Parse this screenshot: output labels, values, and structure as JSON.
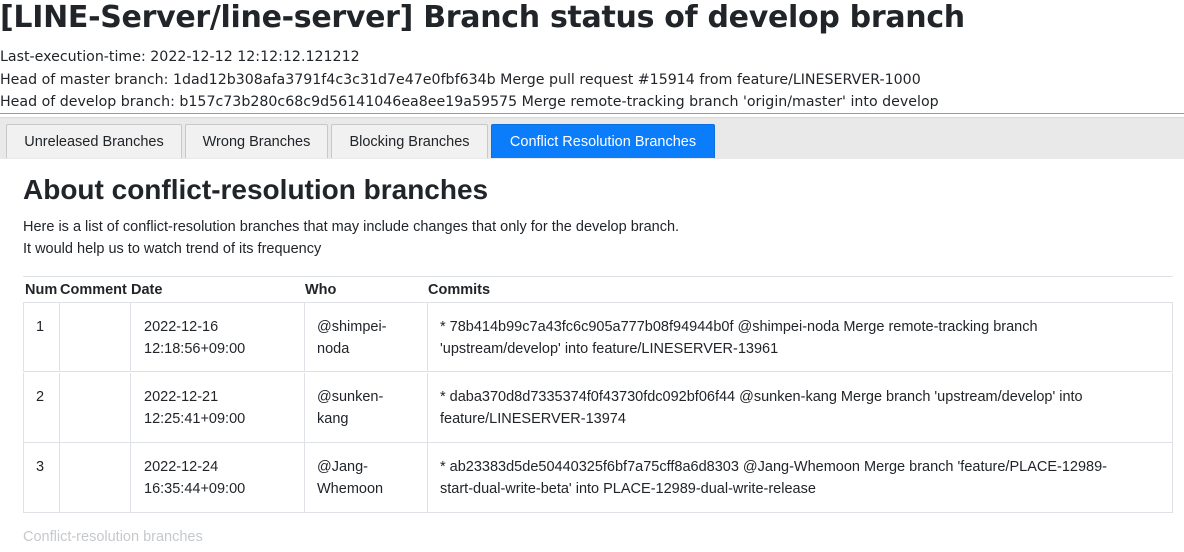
{
  "page": {
    "title": "[LINE-Server/line-server] Branch status of develop branch",
    "last_execution": "Last-execution-time: 2022-12-12 12:12:12.121212",
    "master_head": "Head of master branch: 1dad12b308afa3791f4c3c31d7e47e0fbf634b Merge pull request #15914 from feature/LINESERVER-1000",
    "develop_head": "Head of develop branch: b157c73b280c68c9d56141046ea8ee19a59575 Merge remote-tracking branch 'origin/master' into develop"
  },
  "tabs": [
    {
      "label": "Unreleased Branches",
      "active": false
    },
    {
      "label": "Wrong Branches",
      "active": false
    },
    {
      "label": "Blocking Branches",
      "active": false
    },
    {
      "label": "Conflict Resolution Branches",
      "active": true
    }
  ],
  "content": {
    "heading": "About conflict-resolution branches",
    "description_line1": "Here is a list of conflict-resolution branches that may include changes that only for the develop branch.",
    "description_line2": "It would help us to watch trend of its frequency",
    "footer_note": "Conflict-resolution branches"
  },
  "table": {
    "headers": {
      "num": "Num",
      "comment": "Comment",
      "date": "Date",
      "who": "Who",
      "commits": "Commits"
    },
    "rows": [
      {
        "num": "1",
        "comment": "",
        "date_line1": "2022-12-16",
        "date_line2": "12:18:56+09:00",
        "who_line1": "@shimpei-",
        "who_line2": "noda",
        "commits_line1": "* 78b414b99c7a43fc6c905a777b08f94944b0f @shimpei-noda Merge remote-tracking branch",
        "commits_line2": "'upstream/develop' into feature/LINESERVER-13961"
      },
      {
        "num": "2",
        "comment": "",
        "date_line1": "2022-12-21",
        "date_line2": "12:25:41+09:00",
        "who_line1": "@sunken-",
        "who_line2": "kang",
        "commits_line1": "* daba370d8d7335374f0f43730fdc092bf06f44 @sunken-kang Merge branch 'upstream/develop' into",
        "commits_line2": "feature/LINESERVER-13974"
      },
      {
        "num": "3",
        "comment": "",
        "date_line1": "2022-12-24",
        "date_line2": "16:35:44+09:00",
        "who_line1": "@Jang-",
        "who_line2": "Whemoon",
        "commits_line1": "* ab23383d5de50440325f6bf7a75cff8a6d8303 @Jang-Whemoon Merge branch 'feature/PLACE-12989-",
        "commits_line2": "start-dual-write-beta' into PLACE-12989-dual-write-release"
      }
    ]
  }
}
